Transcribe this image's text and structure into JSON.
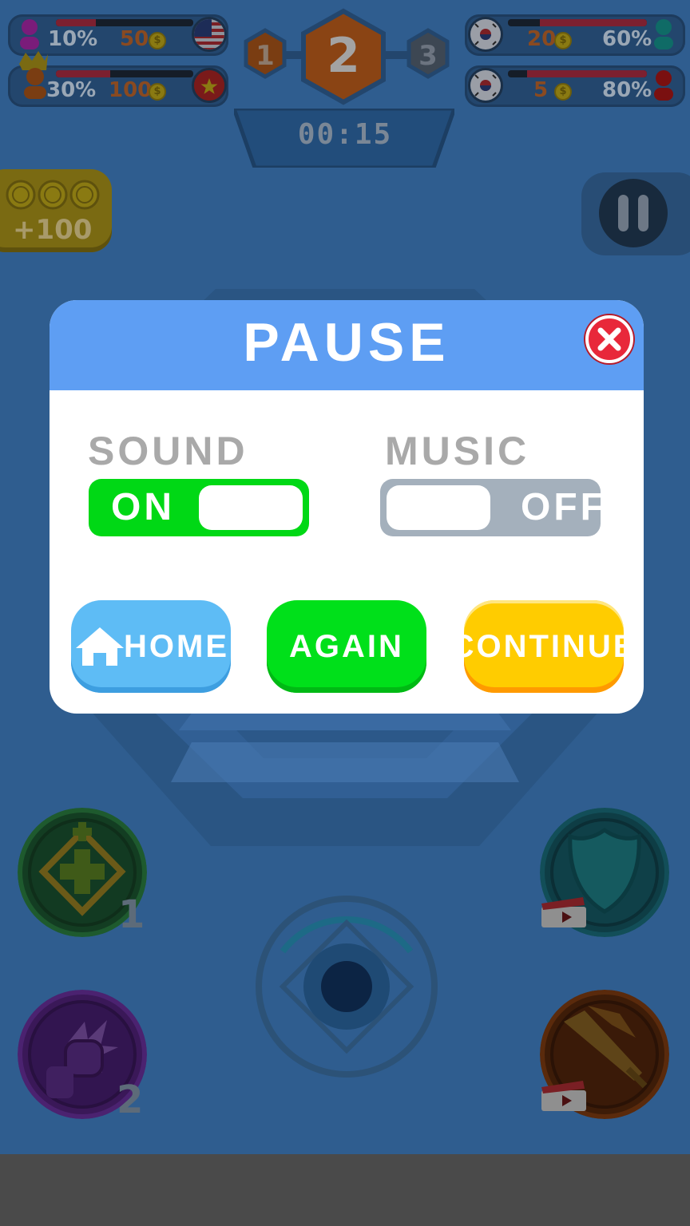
{
  "players": [
    {
      "side": "left",
      "percent": "10%",
      "coins": "50",
      "flag": "usa-flag",
      "avatar": "magenta-person-icon",
      "hp": 0.25
    },
    {
      "side": "left",
      "percent": "30%",
      "coins": "100",
      "flag": "vietnam-flag",
      "avatar": "crowned-person-icon",
      "hp": 0.4
    },
    {
      "side": "right",
      "percent": "60%",
      "coins": "20",
      "flag": "korea-flag",
      "avatar": "teal-person-icon",
      "hp": 0.8
    },
    {
      "side": "right",
      "percent": "80%",
      "coins": "5",
      "flag": "korea-flag",
      "avatar": "red-person-icon",
      "hp": 0.9
    }
  ],
  "coin_symbol": "$",
  "stages": {
    "prev": "1",
    "current": "2",
    "next": "3"
  },
  "timer": "00:15",
  "bonus": {
    "label": "+100"
  },
  "abilities": {
    "heal_count": "1",
    "power_count": "2"
  },
  "dialog": {
    "title": "PAUSE",
    "sound": {
      "label": "SOUND",
      "state": "ON"
    },
    "music": {
      "label": "MUSIC",
      "state": "OFF"
    },
    "buttons": {
      "home": "HOME",
      "again": "AGAIN",
      "continue": "CONTINUE"
    }
  },
  "colors": {
    "header": "#5e9ef3",
    "toggle_on": "#00d815",
    "toggle_off": "#a4b0bc",
    "home": "#5ebcf5",
    "again": "#00e01a",
    "continue": "#ffcc00",
    "close": "#e8283a"
  }
}
